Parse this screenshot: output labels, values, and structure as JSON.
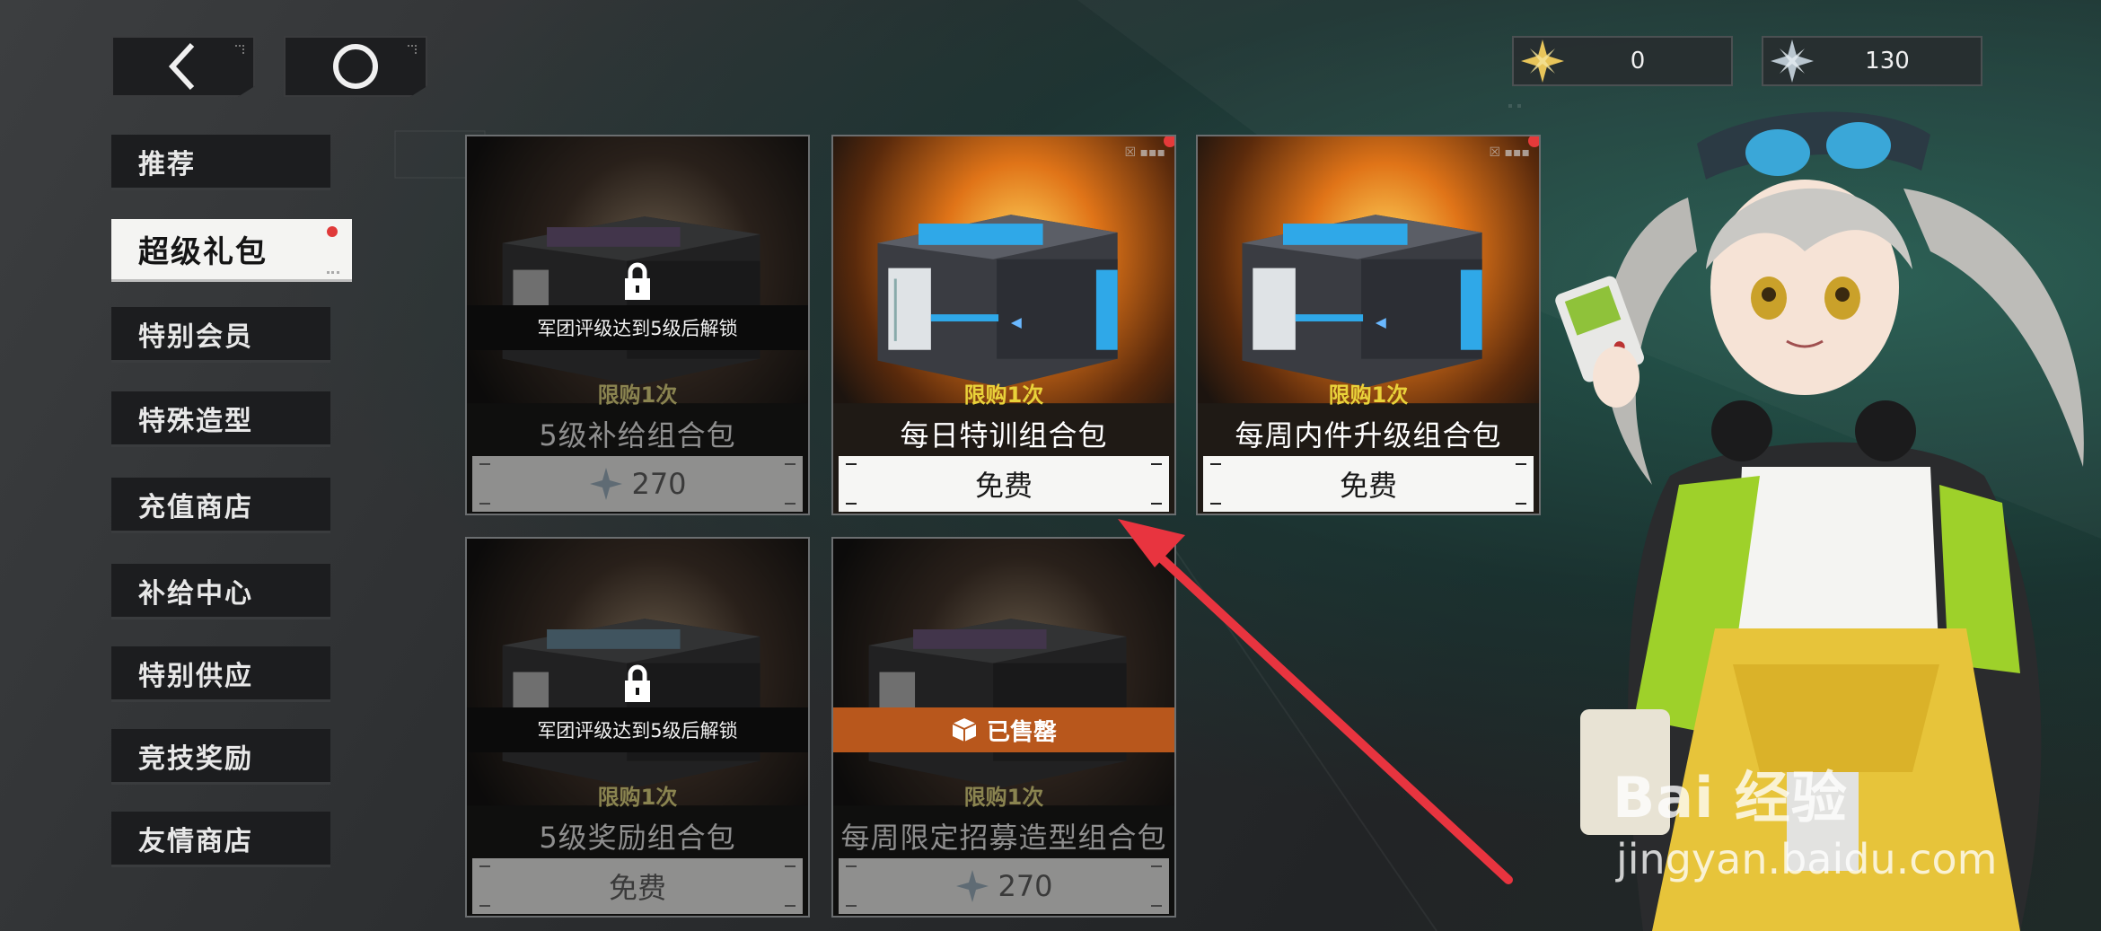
{
  "topbar": {
    "back_icon": "chevron-left-icon",
    "home_icon": "ring-icon"
  },
  "currency": [
    {
      "icon": "gold-star-icon",
      "value": "0",
      "color": "#e8c55a"
    },
    {
      "icon": "silver-star-icon",
      "value": "130",
      "color": "#b9c6cf"
    }
  ],
  "sidebar": {
    "items": [
      {
        "label": "推荐"
      },
      {
        "label": "超级礼包",
        "active": true
      },
      {
        "label": "特别会员"
      },
      {
        "label": "特殊造型"
      },
      {
        "label": "充值商店"
      },
      {
        "label": "补给中心"
      },
      {
        "label": "特别供应"
      },
      {
        "label": "竞技奖励"
      },
      {
        "label": "友情商店"
      }
    ]
  },
  "cards": [
    {
      "limit": "限购1次",
      "name": "5级补给组合包",
      "price": "270",
      "price_icon": "silver-star-icon",
      "lock": "军团评级达到5级后解锁",
      "box_color": "purple"
    },
    {
      "limit": "限购1次",
      "name": "每日特训组合包",
      "price": "免费",
      "box_color": "blue",
      "badge_dot": true
    },
    {
      "limit": "限购1次",
      "name": "每周内件升级组合包",
      "price": "免费",
      "box_color": "blue",
      "badge_dot": true
    },
    {
      "limit": "限购1次",
      "name": "5级奖励组合包",
      "price": "免费",
      "lock": "军团评级达到5级后解锁",
      "box_color": "blue"
    },
    {
      "limit": "限购1次",
      "name": "每周限定招募造型组合包",
      "price": "270",
      "price_icon": "silver-star-icon",
      "sold": "已售罄",
      "box_color": "purple"
    }
  ],
  "watermark": {
    "logo": "Bai 经验",
    "url": "jingyan.baidu.com"
  },
  "colors": {
    "accent_red": "#e53a3a",
    "limit_yellow": "#e9d23a",
    "sold_orange": "#b8571c",
    "arrow_red": "#e8343f"
  }
}
